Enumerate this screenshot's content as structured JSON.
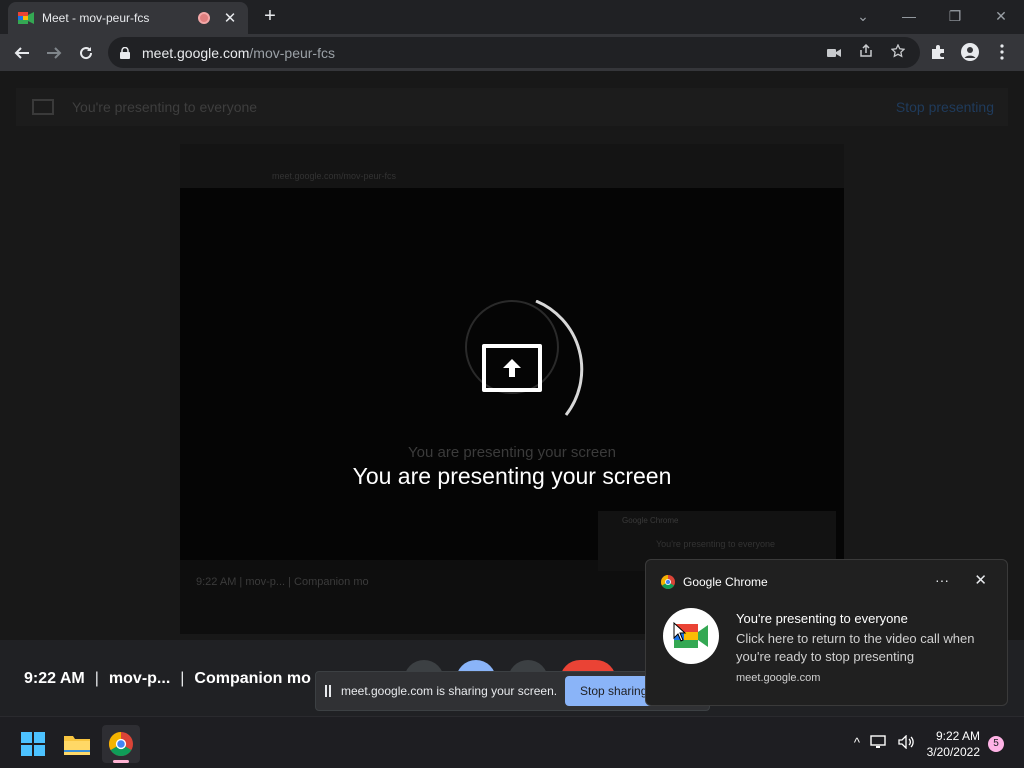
{
  "browser": {
    "tab": {
      "title": "Meet - mov-peur-fcs",
      "close": "✕"
    },
    "new_tab": "+",
    "window_controls": {
      "minimize": "—",
      "maximize": "❐",
      "close": "✕",
      "dropdown": "⌄"
    },
    "url_host": "meet.google.com",
    "url_path": "/mov-peur-fcs"
  },
  "page": {
    "dim_bar_text": "You're presenting to everyone",
    "dim_stop_presenting": "Stop presenting",
    "ghost_message": "You are presenting your screen",
    "main_message": "You are presenting your screen",
    "mirror_bottom": "9:22 AM  |  mov-p...  |  Companion mo",
    "mirror_url": "meet.google.com/mov-peur-fcs",
    "ghost_notif_title": "Google Chrome",
    "ghost_notif_body": "You're presenting to everyone"
  },
  "meet_bar": {
    "time": "9:22 AM",
    "meeting_code": "mov-p...",
    "mode": "Companion mo"
  },
  "share_bar": {
    "text": "meet.google.com is sharing your screen.",
    "stop_button": "Stop sharing"
  },
  "notification": {
    "app": "Google Chrome",
    "more": "···",
    "close": "✕",
    "title": "You're presenting to everyone",
    "body": "Click here to return to the video call when you're ready to stop presenting",
    "source": "meet.google.com"
  },
  "taskbar": {
    "time": "9:22 AM",
    "date": "3/20/2022",
    "badge": "5",
    "tray_chevron": "^"
  },
  "colors": {
    "accent_blue": "#8ab4f8",
    "meet_red": "#ea4335",
    "background": "#202124"
  }
}
